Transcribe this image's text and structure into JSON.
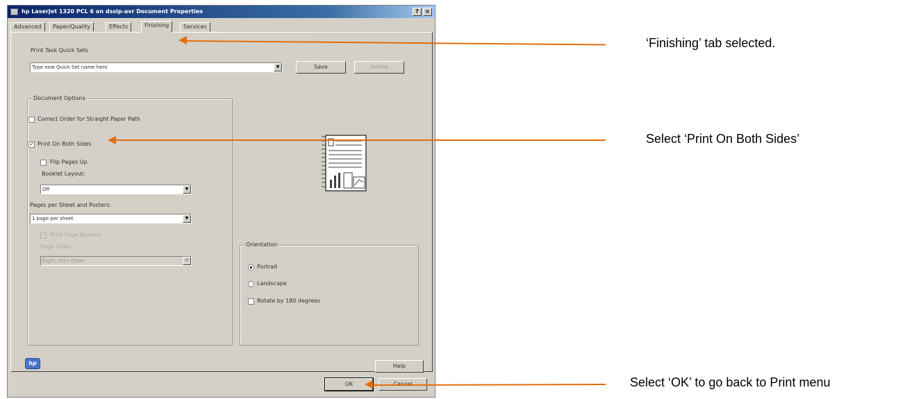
{
  "window": {
    "title": "hp LaserJet 1320 PCL 6 on dsslp-avr Document Properties",
    "help_btn": "?",
    "close_btn": "×"
  },
  "tabs": [
    {
      "label": "Advanced"
    },
    {
      "label": "Paper/Quality"
    },
    {
      "label": "Effects"
    },
    {
      "label": "Finishing",
      "selected": true
    },
    {
      "label": "Services"
    }
  ],
  "quick_sets": {
    "label": "Print Task Quick Sets",
    "value": "Type new Quick Set name here",
    "save_label": "Save",
    "delete_label": "Delete"
  },
  "document_options": {
    "label": "Document Options",
    "correct_order_label": "Correct Order for Straight Paper Path",
    "correct_order_checked": false,
    "both_sides_label": "Print On Both Sides",
    "both_sides_checked": true,
    "flip_pages_label": "Flip Pages Up",
    "flip_pages_checked": false,
    "booklet_label": "Booklet Layout:",
    "booklet_value": "Off",
    "pages_per_sheet_label": "Pages per Sheet and Posters:",
    "pages_per_sheet_value": "1 page per sheet",
    "print_borders_label": "Print Page Borders",
    "page_order_label": "Page Order:",
    "page_order_value": "Right, then Down"
  },
  "orientation": {
    "label": "Orientation",
    "portrait_label": "Portrait",
    "landscape_label": "Landscape",
    "rotate_label": "Rotate by 180 degrees",
    "selected": "portrait"
  },
  "buttons": {
    "help": "Help",
    "ok": "OK",
    "cancel": "Cancel"
  },
  "logo": {
    "text": "hp"
  },
  "annotations": {
    "finishing": "‘Finishing’ tab selected.",
    "both_sides": "Select ‘Print On Both Sides’",
    "ok": "Select ‘OK’ to go back to Print menu"
  },
  "colors": {
    "accent": "#e46c0a",
    "dialog_bg": "#d4d0c8",
    "titlebar": "#0a246a"
  }
}
